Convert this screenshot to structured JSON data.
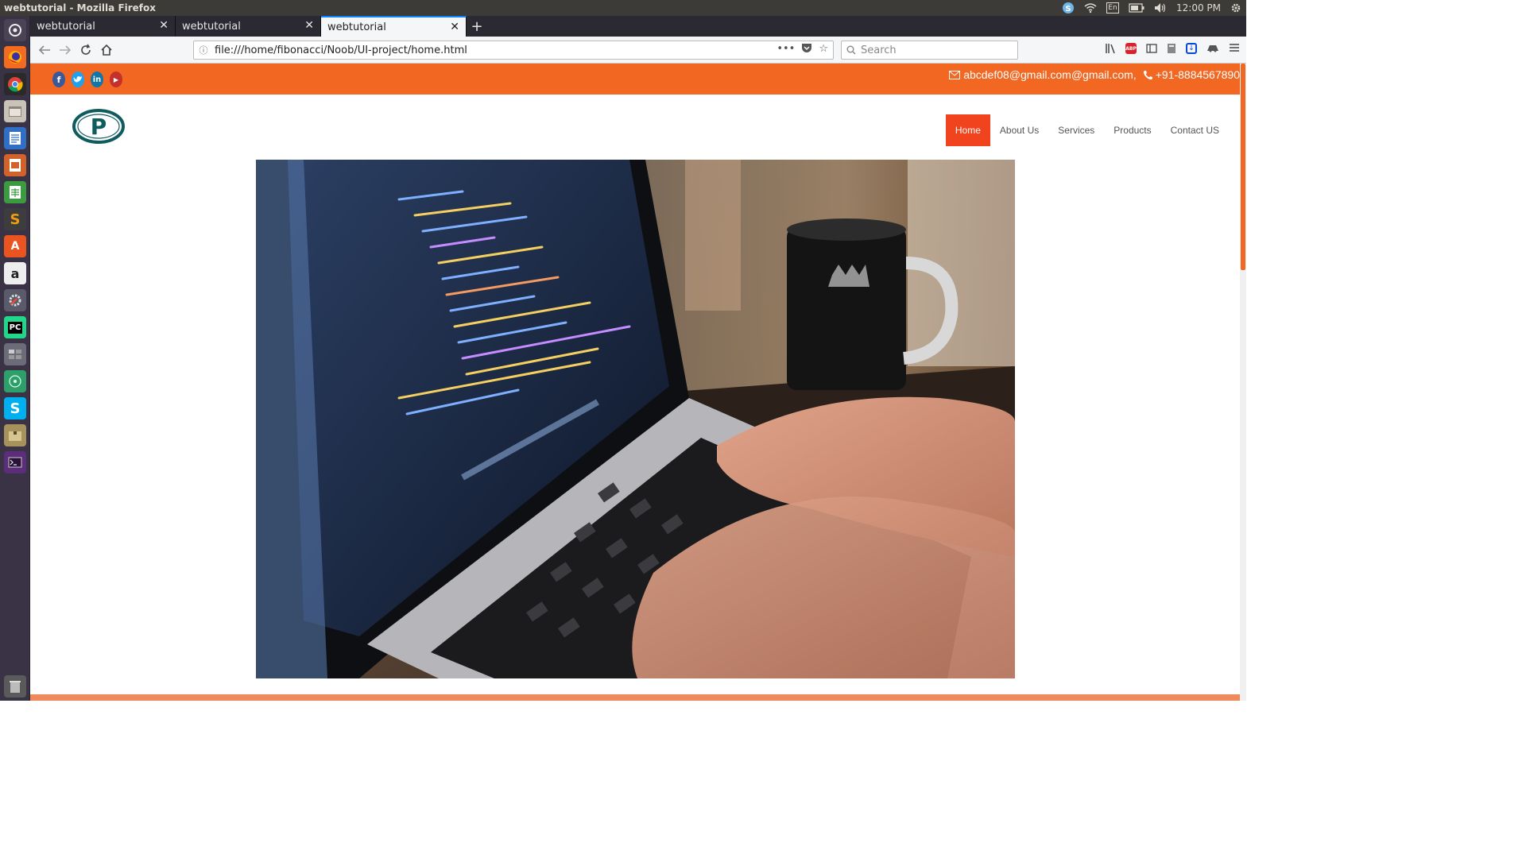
{
  "os": {
    "window_title": "webtutorial - Mozilla Firefox",
    "keyboard_layout": "En",
    "clock": "12:00 PM"
  },
  "browser": {
    "tabs": [
      {
        "title": "webtutorial",
        "active": false
      },
      {
        "title": "webtutorial",
        "active": false
      },
      {
        "title": "webtutorial",
        "active": true
      }
    ],
    "url": "file:///home/fibonacci/Noob/UI-project/home.html",
    "search_placeholder": "Search"
  },
  "site": {
    "social_icons": [
      "facebook-icon",
      "twitter-icon",
      "linkedin-icon",
      "youtube-icon"
    ],
    "email": "abcdef08@gmail.com@gmail.com,",
    "phone": "+91-8884567890",
    "nav": [
      {
        "label": "Home",
        "active": true
      },
      {
        "label": "About Us",
        "active": false
      },
      {
        "label": "Services",
        "active": false
      },
      {
        "label": "Products",
        "active": false
      },
      {
        "label": "Contact US",
        "active": false
      }
    ],
    "logo_letter": "P",
    "colors": {
      "accent": "#f26722",
      "nav_active": "#f2431f",
      "logo": "#0e5c5e"
    }
  }
}
